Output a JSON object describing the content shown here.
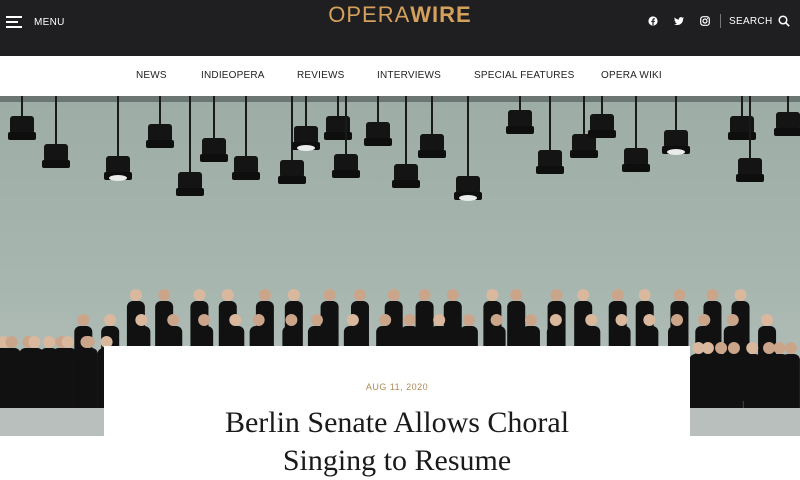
{
  "header": {
    "menu_label": "MENU",
    "logo_opera": "OPERA",
    "logo_wire": "WIRE",
    "social": [
      "facebook-icon",
      "twitter-icon",
      "instagram-icon"
    ],
    "search_label": "SEARCH",
    "brand_color": "#d4a15c",
    "bar_color": "#1f1e20"
  },
  "nav": {
    "items": [
      {
        "label": "NEWS"
      },
      {
        "label": "INDIEOPERA"
      },
      {
        "label": "REVIEWS"
      },
      {
        "label": "INTERVIEWS"
      },
      {
        "label": "SPECIAL FEATURES"
      },
      {
        "label": "OPERA WIKI"
      }
    ]
  },
  "article": {
    "date": "AUG 11, 2020",
    "title_line1": "Berlin Senate Allows Choral",
    "title_line2": "Singing to Resume"
  }
}
